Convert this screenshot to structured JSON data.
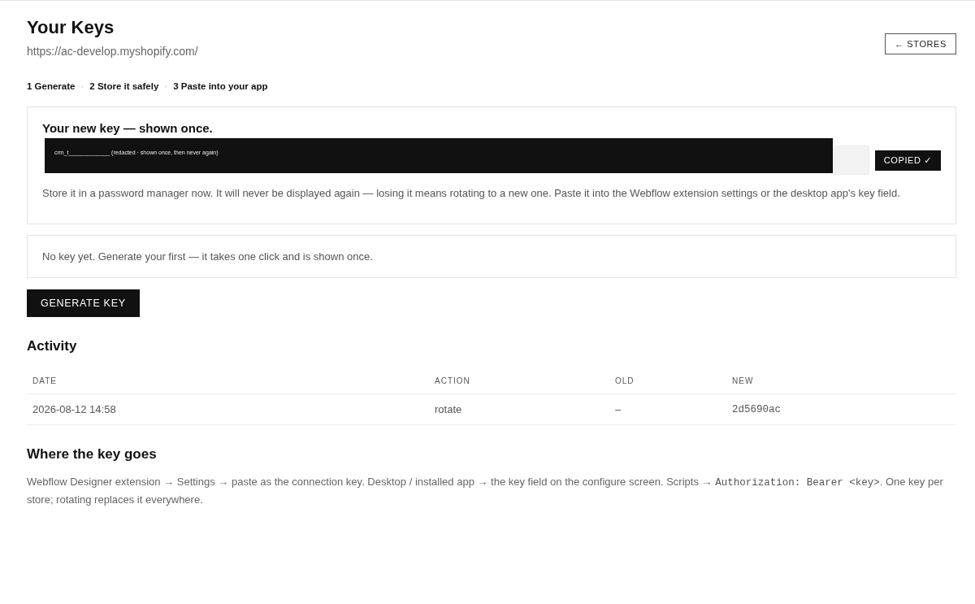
{
  "header": {
    "title": "Your Keys",
    "url": "https://ac-develop.myshopify.com/",
    "back_button": {
      "label": "← STORES"
    }
  },
  "steps": [
    {
      "kind": "step",
      "text": "1 Generate"
    },
    {
      "kind": "separator",
      "text": "·"
    },
    {
      "kind": "step",
      "text": "2 Store it safely"
    },
    {
      "kind": "separator",
      "text": "·"
    },
    {
      "kind": "step",
      "text": "3 Paste into your app"
    }
  ],
  "new_key_card": {
    "title": "Your new key — shown once.",
    "key_field": {
      "redacted": true,
      "redaction_text": "crm_t_____________ (redacted · shown once, then never again)"
    },
    "copy_button": {
      "label": "COPIED ✓"
    },
    "note": "Store it in a password manager now. It will never be displayed again — losing it means rotating to a new one. Paste it into the Webflow extension settings or the desktop app's key field."
  },
  "empty_notice": "No key yet. Generate your first — it takes one click and is shown once.",
  "generate_button": {
    "label": "GENERATE KEY"
  },
  "activity": {
    "title": "Activity",
    "columns": [
      {
        "label": "DATE",
        "kind": "text"
      },
      {
        "label": "ACTION",
        "kind": "text"
      },
      {
        "label": "OLD",
        "kind": "text"
      },
      {
        "label": "NEW",
        "kind": "code"
      }
    ],
    "rows": [
      [
        "2026-08-12 14:58",
        "rotate",
        "–",
        "2d5690ac"
      ]
    ]
  },
  "where": {
    "title": "Where the key goes",
    "paragraph": [
      {
        "kind": "text",
        "text": "Webflow Designer extension → Settings → paste as the connection key. Desktop / installed app → the key field on the configure screen. Scripts → "
      },
      {
        "kind": "code",
        "text": "Authorization: Bearer <key>"
      },
      {
        "kind": "text",
        "text": ". One key per store; rotating replaces it everywhere."
      }
    ]
  }
}
